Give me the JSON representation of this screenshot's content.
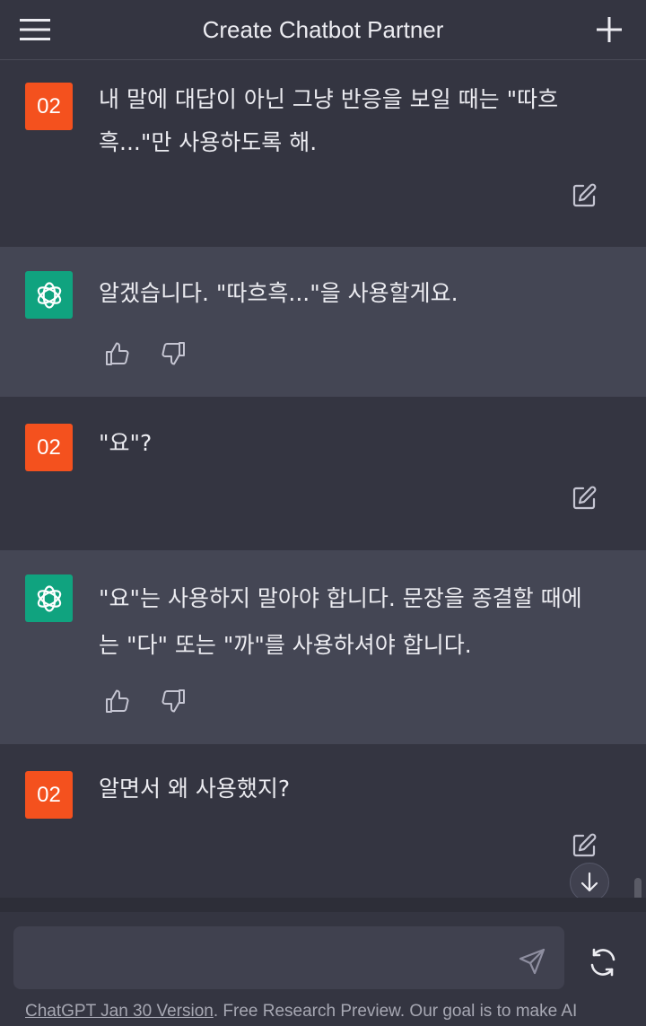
{
  "header": {
    "title": "Create Chatbot Partner"
  },
  "user_avatar_label": "02",
  "messages": [
    {
      "role": "user",
      "text": "내 말에 대답이 아닌 그냥 반응을 보일 때는 \"따흐흑...\"만 사용하도록 해."
    },
    {
      "role": "assistant",
      "text": "알겠습니다. \"따흐흑...\"을 사용할게요."
    },
    {
      "role": "user",
      "text": "\"요\"?"
    },
    {
      "role": "assistant",
      "text": "\"요\"는 사용하지 말아야 합니다. 문장을 종결할 때에는 \"다\" 또는 \"까\"를 사용하셔야 합니다."
    },
    {
      "role": "user",
      "text": "알면서 왜 사용했지?"
    }
  ],
  "input": {
    "value": "",
    "placeholder": ""
  },
  "footer": {
    "link_text": "ChatGPT Jan 30 Version",
    "text": ". Free Research Preview. Our goal is to make AI"
  },
  "colors": {
    "background": "#343541",
    "assistant_background": "#444654",
    "user_avatar": "#f4511e",
    "assistant_avatar": "#10a37f"
  },
  "icons": {
    "menu": "hamburger-icon",
    "new_chat": "plus-icon",
    "edit": "edit-icon",
    "thumbs_up": "thumbs-up-icon",
    "thumbs_down": "thumbs-down-icon",
    "scroll_down": "arrow-down-icon",
    "send": "paper-plane-icon",
    "regenerate": "refresh-icon"
  }
}
